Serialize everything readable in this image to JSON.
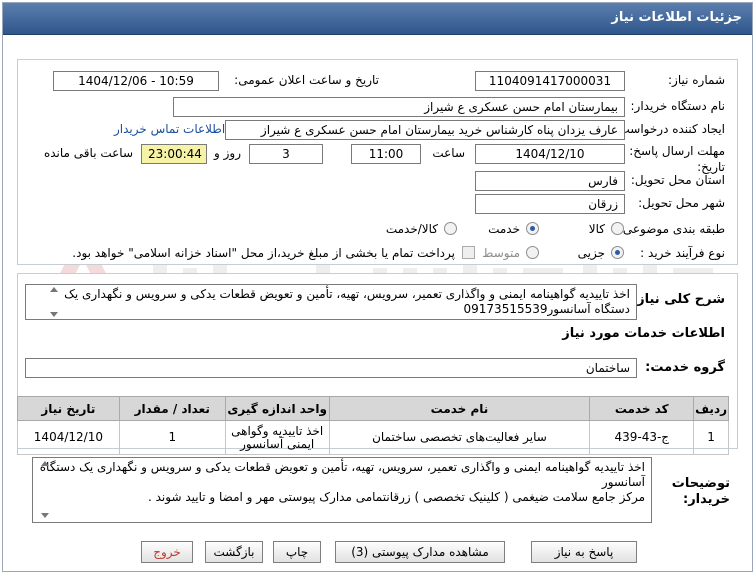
{
  "header": {
    "title": "جزئیات اطلاعات نیاز"
  },
  "form": {
    "need_number_label": "شماره نیاز:",
    "need_number": "1104091417000031",
    "announce_label": "تاریخ و ساعت اعلان عمومی:",
    "announce_value": "1404/12/06 - 10:59",
    "buyer_label": "نام دستگاه خریدار:",
    "buyer_value": "بیمارستان امام حسن عسکری  ع  شیراز",
    "creator_label": "ایجاد کننده درخواست:",
    "creator_value": "عارف یزدان پناه کارشناس خرید  بیمارستان امام حسن عسکری  ع  شیراز",
    "contact_link": "اطلاعات تماس خریدار",
    "deadline_label_1": "مهلت ارسال پاسخ: تا",
    "deadline_label_2": "تاریخ:",
    "deadline_date": "1404/12/10",
    "time_label": "ساعت",
    "deadline_time": "11:00",
    "days_value": "3",
    "days_label": "روز و",
    "remaining_time": "23:00:44",
    "remaining_label": "ساعت باقی مانده",
    "province_label": "استان محل تحویل:",
    "province_value": "فارس",
    "city_label": "شهر محل تحویل:",
    "city_value": "زرقان",
    "category_label": "طبقه بندی موضوعی:",
    "category_options": [
      "کالا",
      "خدمت",
      "کالا/خدمت"
    ],
    "process_label": "نوع فرآیند خرید :",
    "process_options": [
      "جزیی",
      "متوسط"
    ],
    "payment_note": "پرداخت تمام یا بخشی از مبلغ خرید،از محل \"اسناد خزانه اسلامی\" خواهد بود."
  },
  "description": {
    "label": "شرح کلی نیاز:",
    "text": "اخذ تاییدیه گواهینامه  ایمنی و  واگذاری تعمیر، سرویس، تهیه، تأمین و تعویض قطعات یدکی و سرویس و نگهداری  یک دستگاه آسانسور09173515539"
  },
  "services": {
    "section_title": "اطلاعات خدمات مورد نیاز",
    "group_label": "گروه خدمت:",
    "group_value": "ساختمان",
    "columns": [
      "ردیف",
      "کد خدمت",
      "نام خدمت",
      "واحد اندازه گیری",
      "تعداد / مقدار",
      "تاریخ نیاز"
    ],
    "rows": [
      {
        "row": "1",
        "code": "ج-43-439",
        "name": "سایر فعالیت‌های تخصصی ساختمان",
        "unit": "اخذ تاییدیه وگواهی ایمنی آسانسور",
        "qty": "1",
        "date": "1404/12/10"
      }
    ]
  },
  "buyer_notes": {
    "label_1": "توضیحات",
    "label_2": "خریدار:",
    "line_1": "اخذ تاییدیه گواهینامه  ایمنی و  واگذاری تعمیر، سرویس، تهیه، تأمین و تعویض قطعات یدکی و سرویس و نگهداری  یک دستگاه آسانسور",
    "line_2": "مرکز جامع سلامت ضیغمی ( کلینیک تخصصی ) زرقانتمامی مدارک پیوستی مهر و امضا و تایید شوند ."
  },
  "buttons": {
    "reply": "پاسخ به نیاز",
    "attachments": "مشاهده مدارک پیوستی (3)",
    "print": "چاپ",
    "back": "بازگشت",
    "exit": "خروج"
  }
}
